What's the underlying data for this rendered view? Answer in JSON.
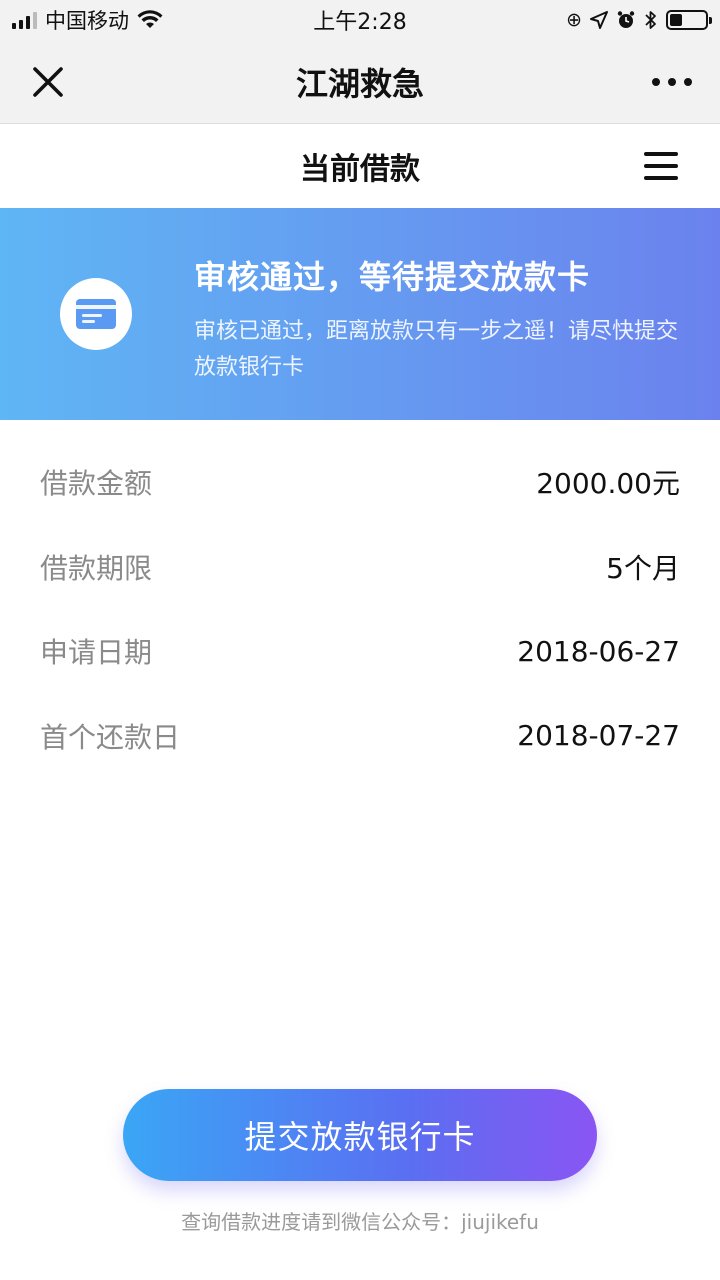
{
  "status_bar": {
    "carrier": "中国移动",
    "time": "上午2:28",
    "battery_level_percent": 35
  },
  "nav": {
    "title": "江湖救急"
  },
  "page": {
    "title": "当前借款"
  },
  "banner": {
    "title": "审核通过，等待提交放款卡",
    "description": "审核已通过，距离放款只有一步之遥！请尽快提交放款银行卡",
    "icon": "card-icon"
  },
  "loan_info": [
    {
      "label": "借款金额",
      "value": "2000.00元"
    },
    {
      "label": "借款期限",
      "value": "5个月"
    },
    {
      "label": "申请日期",
      "value": "2018-06-27"
    },
    {
      "label": "首个还款日",
      "value": "2018-07-27"
    }
  ],
  "actions": {
    "submit_label": "提交放款银行卡"
  },
  "footer": {
    "note": "查询借款进度请到微信公众号：jiujikefu"
  },
  "colors": {
    "banner_start": "#5fb6f4",
    "banner_end": "#6b82ee",
    "button_start": "#3aa6f5",
    "button_end": "#8a55f3"
  }
}
